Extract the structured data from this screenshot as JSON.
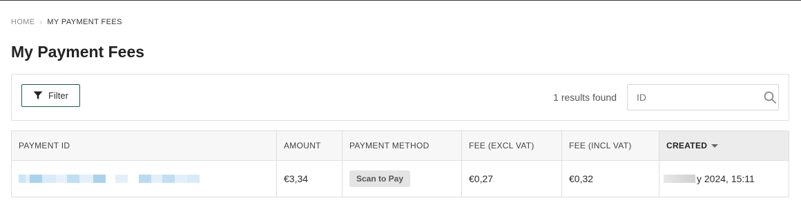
{
  "breadcrumb": {
    "home": "HOME",
    "separator": "›",
    "current": "MY PAYMENT FEES"
  },
  "page": {
    "title": "My Payment Fees"
  },
  "toolbar": {
    "filter_label": "Filter",
    "results_text": "1 results found",
    "search": {
      "placeholder": "ID",
      "value": ""
    }
  },
  "table": {
    "columns": [
      "PAYMENT ID",
      "AMOUNT",
      "PAYMENT METHOD",
      "FEE (EXCL VAT)",
      "FEE (INCL VAT)",
      "CREATED"
    ],
    "sorted_column": "CREATED",
    "sort_direction": "descending",
    "rows": [
      {
        "payment_id": "",
        "amount": "€3,34",
        "payment_method": "Scan to Pay",
        "fee_excl_vat": "€0,27",
        "fee_incl_vat": "€0,32",
        "created": "y 2024, 15:11"
      }
    ]
  },
  "colors": {
    "accent": "#1f5a52",
    "redacted_blue": "#a9d3ee",
    "border": "#dedede"
  }
}
